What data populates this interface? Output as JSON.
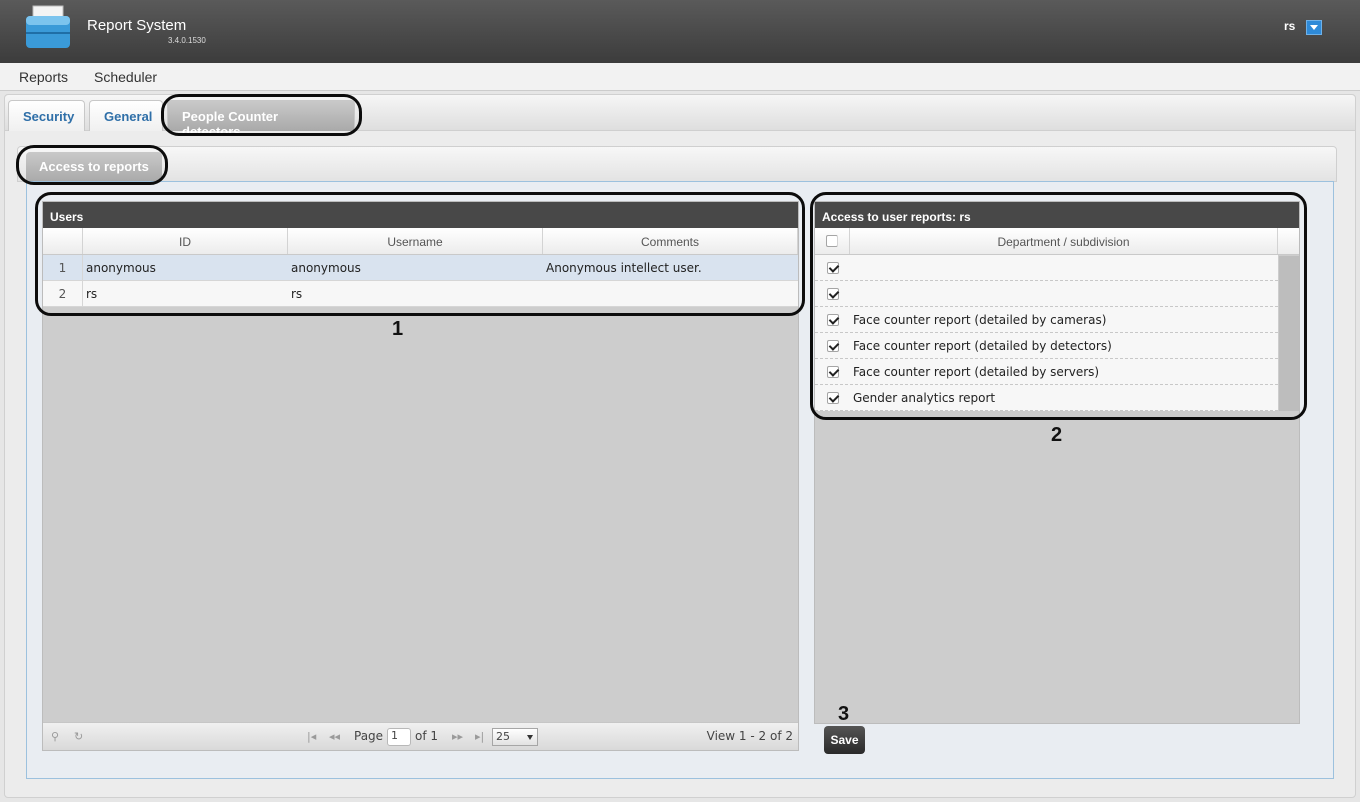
{
  "app": {
    "title": "Report System",
    "version": "3.4.0.1530"
  },
  "user": {
    "name": "rs"
  },
  "menu": {
    "items": [
      "Reports",
      "Scheduler"
    ]
  },
  "tabs": [
    {
      "label": "Security",
      "active": false
    },
    {
      "label": "General",
      "active": false
    },
    {
      "label": "People Counter detectors",
      "active": true
    }
  ],
  "subtab": {
    "label": "Access to reports"
  },
  "users_grid": {
    "caption": "Users",
    "columns": [
      "ID",
      "Username",
      "Comments"
    ],
    "rows": [
      {
        "n": "1",
        "id": "anonymous",
        "username": "anonymous",
        "comments": "Anonymous intellect user.",
        "selected": true
      },
      {
        "n": "2",
        "id": "rs",
        "username": "rs",
        "comments": "",
        "selected": false
      }
    ],
    "pager": {
      "page_label": "Page",
      "page": "1",
      "of_label": "of 1",
      "rows_per_page": "25",
      "view": "View 1 - 2 of 2"
    }
  },
  "access_grid": {
    "caption": "Access to user reports: rs",
    "column": "Department / subdivision",
    "rows": [
      {
        "label": "",
        "checked": true
      },
      {
        "label": "",
        "checked": true
      },
      {
        "label": "Face counter report (detailed by cameras)",
        "checked": true
      },
      {
        "label": "Face counter report (detailed by detectors)",
        "checked": true
      },
      {
        "label": "Face counter report (detailed by servers)",
        "checked": true
      },
      {
        "label": "Gender analytics report",
        "checked": true
      }
    ]
  },
  "callouts": [
    "1",
    "2",
    "3"
  ],
  "save_label": "Save",
  "colors": {
    "header": "#484848",
    "accent": "#2e8ad8",
    "tab_text": "#2f6fa8",
    "selected_row": "#d9e3ef"
  }
}
